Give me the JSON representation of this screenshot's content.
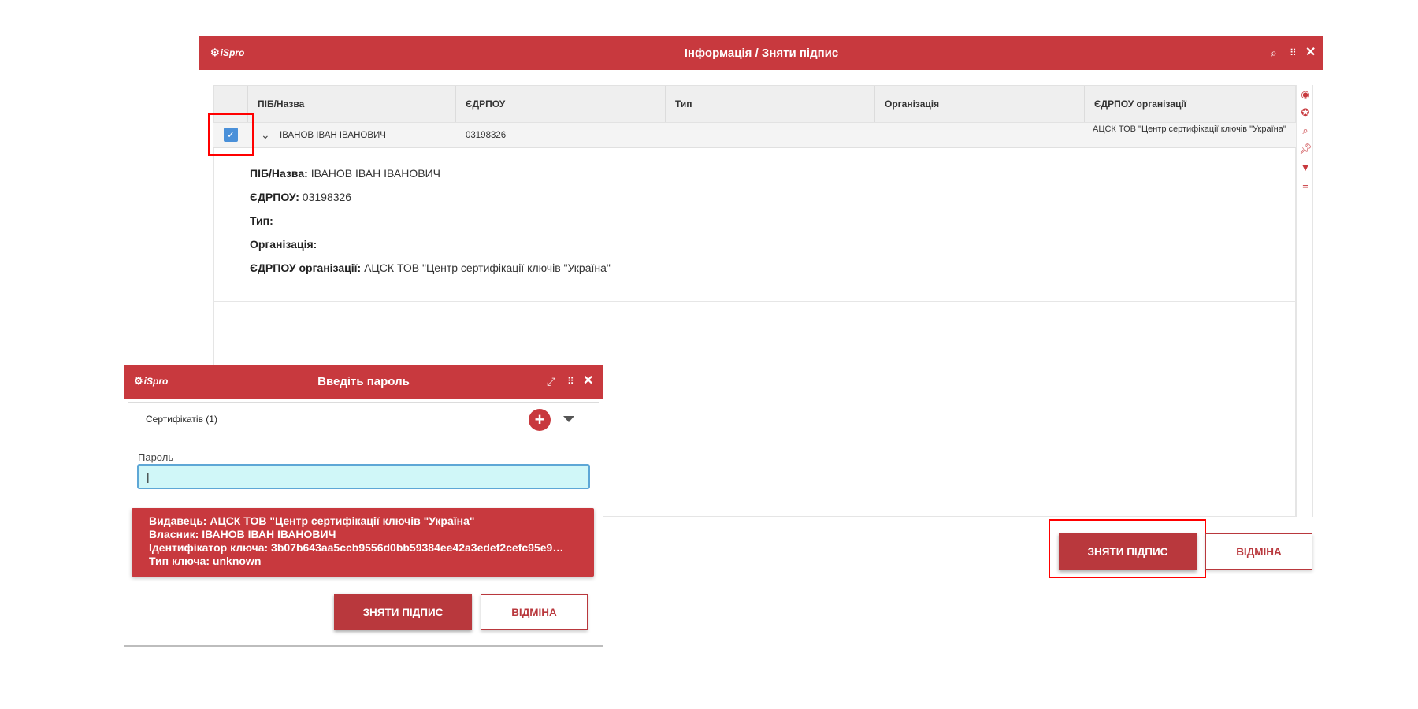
{
  "main_window": {
    "logo": "iSpro",
    "title": "Інформація / Зняти підпис",
    "header_icons": [
      "search-icon",
      "drag-grip-icon",
      "close-icon"
    ]
  },
  "grid": {
    "columns": [
      "ПІБ/Назва",
      "ЄДРПОУ",
      "Тип",
      "Організація",
      "ЄДРПОУ організації"
    ],
    "row": {
      "selected": true,
      "name": "ІВАНОВ ІВАН ІВАНОВИЧ",
      "edrpou": "03198326",
      "type": "",
      "organization": "",
      "org_edrpou": "АЦСК ТОВ \"Центр сертифікації ключів \"Україна\""
    },
    "toolbar_icons": [
      "eye-icon",
      "palette-icon",
      "search-icon",
      "pin-icon",
      "filter-icon",
      "sort-icon"
    ]
  },
  "detail": {
    "name_label": "ПІБ/Назва:",
    "name_value": "ІВАНОВ ІВАН ІВАНОВИЧ",
    "edrpou_label": "ЄДРПОУ:",
    "edrpou_value": "03198326",
    "type_label": "Тип:",
    "type_value": "",
    "org_label": "Організація:",
    "org_value": "",
    "org_edrpou_label": "ЄДРПОУ організації:",
    "org_edrpou_value": "АЦСК ТОВ \"Центр сертифікації ключів \"Україна\""
  },
  "main_buttons": {
    "confirm": "ЗНЯТИ ПІДПИС",
    "cancel": "ВІДМІНА"
  },
  "password_dialog": {
    "logo": "iSpro",
    "title": "Введіть пароль",
    "header_icons": [
      "expand-icon",
      "drag-grip-icon",
      "close-icon"
    ],
    "certificates_label": "Сертифікатів (1)",
    "password_label": "Пароль",
    "password_value": "|",
    "info": {
      "issuer": "Видавець: АЦСК ТОВ \"Центр сертифікації ключів \"Україна\"",
      "owner": "Власник: ІВАНОВ ІВАН ІВАНОВИЧ",
      "key_id": "Ідентифікатор ключа: 3b07b643aa5ccb9556d0bb59384ee42a3edef2cefc95e9…",
      "key_type": "Тип ключа: unknown"
    },
    "confirm": "ЗНЯТИ ПІДПИС",
    "cancel": "ВІДМІНА"
  },
  "colors": {
    "brand_red": "#c8393e",
    "highlight_outline": "#ff0000",
    "checkbox_blue": "#4a90d9",
    "password_bg": "#d0f7f8"
  }
}
